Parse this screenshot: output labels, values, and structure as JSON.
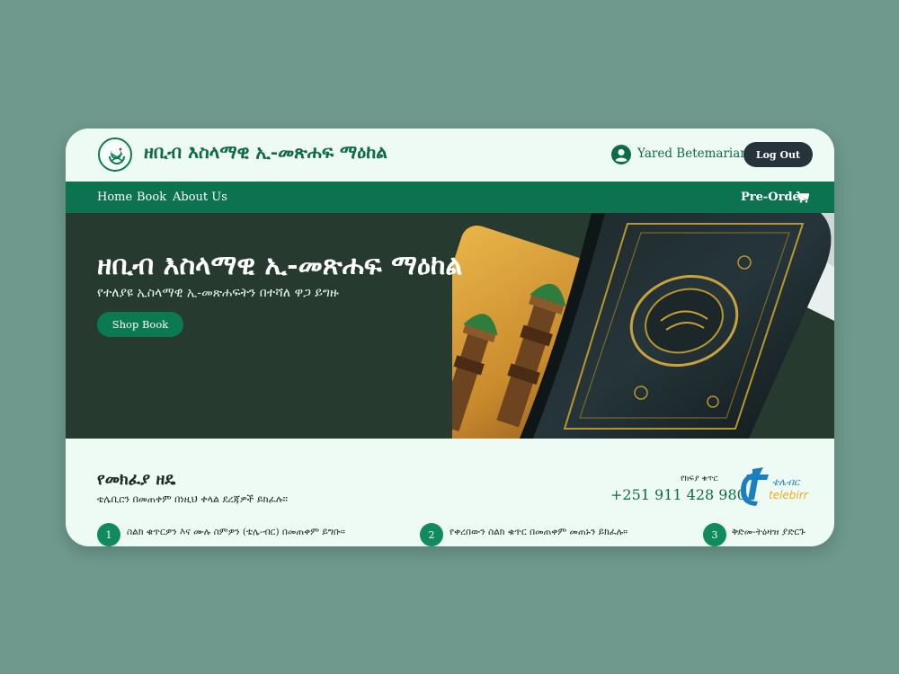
{
  "header": {
    "site_title": "ዘቢብ እስላማዊ ኢ-መጽሐፍ ማዕከል",
    "user_name": "Yared Betemariam",
    "logout_label": "Log Out"
  },
  "nav": {
    "items": [
      {
        "label": "Home"
      },
      {
        "label": "Book"
      },
      {
        "label": "About Us"
      }
    ],
    "preorder_label": "Pre-Order"
  },
  "hero": {
    "title": "ዘቢብ እስላማዊ ኢ-መጽሐፍ ማዕከል",
    "subtitle": "የተለያዩ ኢስላማዊ ኢ-መጽሐፍትን በተሻለ ዋጋ ይግዙ",
    "cta_label": "Shop Book"
  },
  "payment": {
    "title": "የመክፈያ ዘዴ",
    "subtitle": "ቴሌቢርን በመጠቀም በነዚህ ቀላል ደረጃዎች ይክፈሉ።",
    "phone_label": "የክፍያ ቁጥር",
    "phone_number": "+251 911 428 980",
    "provider_amharic": "ቴሌብር",
    "provider_name": "telebirr",
    "steps": [
      {
        "num": "1",
        "text": "ስልክ ቁጥርዎን እና ሙሉ ስምዎን (ቴሌ-ብር) በመጠቀም ይግቡ።"
      },
      {
        "num": "2",
        "text": "የቀረበውን ስልክ ቁጥር በመጠቀም መጠኑን ይክፈሉ።"
      },
      {
        "num": "3",
        "text": "ቅድመ-ትዕዛዝ ያድርጉ"
      }
    ]
  },
  "colors": {
    "background": "#6e998c",
    "card": "#eefbf4",
    "brand_green": "#0c7350",
    "hero_bg": "#263a30",
    "dark_button": "#26333b"
  },
  "icons": [
    "logo-emblem",
    "user-circle-icon",
    "cart-icon",
    "telebirr-logo"
  ]
}
